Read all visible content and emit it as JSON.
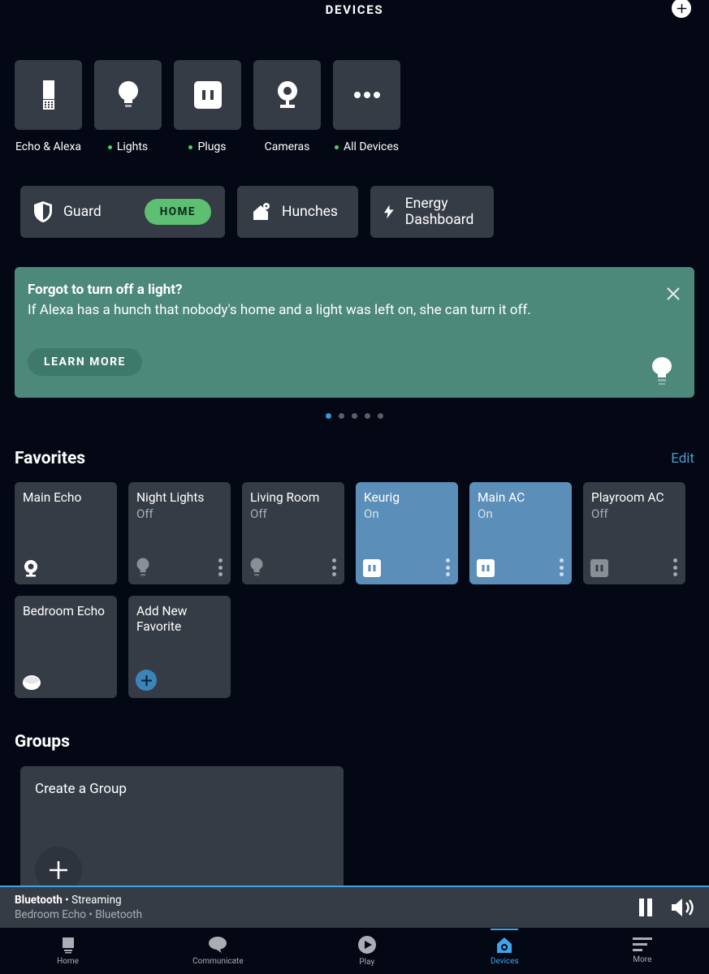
{
  "header": {
    "title": "DEVICES"
  },
  "categories": [
    {
      "label": "Echo & Alexa",
      "dot": false,
      "icon": "echo"
    },
    {
      "label": "Lights",
      "dot": true,
      "icon": "bulb"
    },
    {
      "label": "Plugs",
      "dot": true,
      "icon": "plug"
    },
    {
      "label": "Cameras",
      "dot": false,
      "icon": "camera"
    },
    {
      "label": "All Devices",
      "dot": true,
      "icon": "more"
    }
  ],
  "features": {
    "guard_label": "Guard",
    "guard_badge": "HOME",
    "hunches_label": "Hunches",
    "energy_label": "Energy Dashboard"
  },
  "hunch": {
    "title": "Forgot to turn off a light?",
    "body": "If Alexa has a hunch that nobody's home and a light was left on, she can turn it off.",
    "cta": "LEARN MORE"
  },
  "carousel": {
    "count": 5,
    "active": 0
  },
  "favorites": {
    "title": "Favorites",
    "edit": "Edit",
    "items": [
      {
        "name": "Main Echo",
        "status": "",
        "on": false,
        "icon": "echo-show",
        "menu": false
      },
      {
        "name": "Night Lights",
        "status": "Off",
        "on": false,
        "icon": "bulb-dim",
        "menu": true
      },
      {
        "name": "Living Room",
        "status": "Off",
        "on": false,
        "icon": "bulb-dim",
        "menu": true
      },
      {
        "name": "Keurig",
        "status": "On",
        "on": true,
        "icon": "plug-on",
        "menu": true
      },
      {
        "name": "Main AC",
        "status": "On",
        "on": true,
        "icon": "plug-on",
        "menu": true
      },
      {
        "name": "Playroom AC",
        "status": "Off",
        "on": false,
        "icon": "plug-off",
        "menu": true
      },
      {
        "name": "Bedroom Echo",
        "status": "",
        "on": false,
        "icon": "echo-dot",
        "menu": false
      },
      {
        "name": "Add New Favorite",
        "status": "",
        "on": false,
        "icon": "add",
        "menu": false
      }
    ]
  },
  "groups": {
    "title": "Groups",
    "create": "Create a Group"
  },
  "now_playing": {
    "source": "Bluetooth",
    "state": "Streaming",
    "device": "Bedroom Echo",
    "via": "Bluetooth"
  },
  "bottom_nav": [
    {
      "label": "Home",
      "icon": "home"
    },
    {
      "label": "Communicate",
      "icon": "chat"
    },
    {
      "label": "Play",
      "icon": "play"
    },
    {
      "label": "Devices",
      "icon": "devices",
      "active": true
    },
    {
      "label": "More",
      "icon": "more-lines"
    }
  ]
}
